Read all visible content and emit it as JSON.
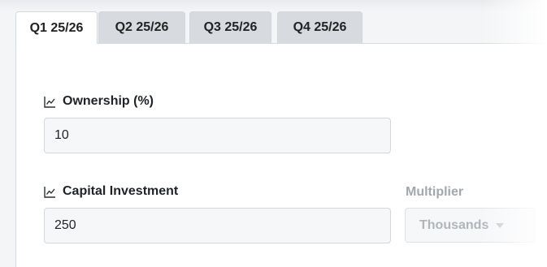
{
  "tabs": [
    {
      "label": "Q1 25/26",
      "active": true
    },
    {
      "label": "Q2 25/26",
      "active": false
    },
    {
      "label": "Q3 25/26",
      "active": false
    },
    {
      "label": "Q4 25/26",
      "active": false
    }
  ],
  "ownership": {
    "label": "Ownership (%)",
    "icon": "chart-line-icon",
    "value": "10"
  },
  "capital": {
    "label": "Capital Investment",
    "icon": "chart-line-icon",
    "value": "250"
  },
  "multiplier": {
    "label": "Multiplier",
    "selected": "Thousands",
    "icon": "caret-down-icon"
  },
  "colors": {
    "active_tab": "#ffffff",
    "inactive_tab": "#d7dadf",
    "input_bg": "#f6f7f9",
    "muted_text": "#a3a8ae"
  }
}
